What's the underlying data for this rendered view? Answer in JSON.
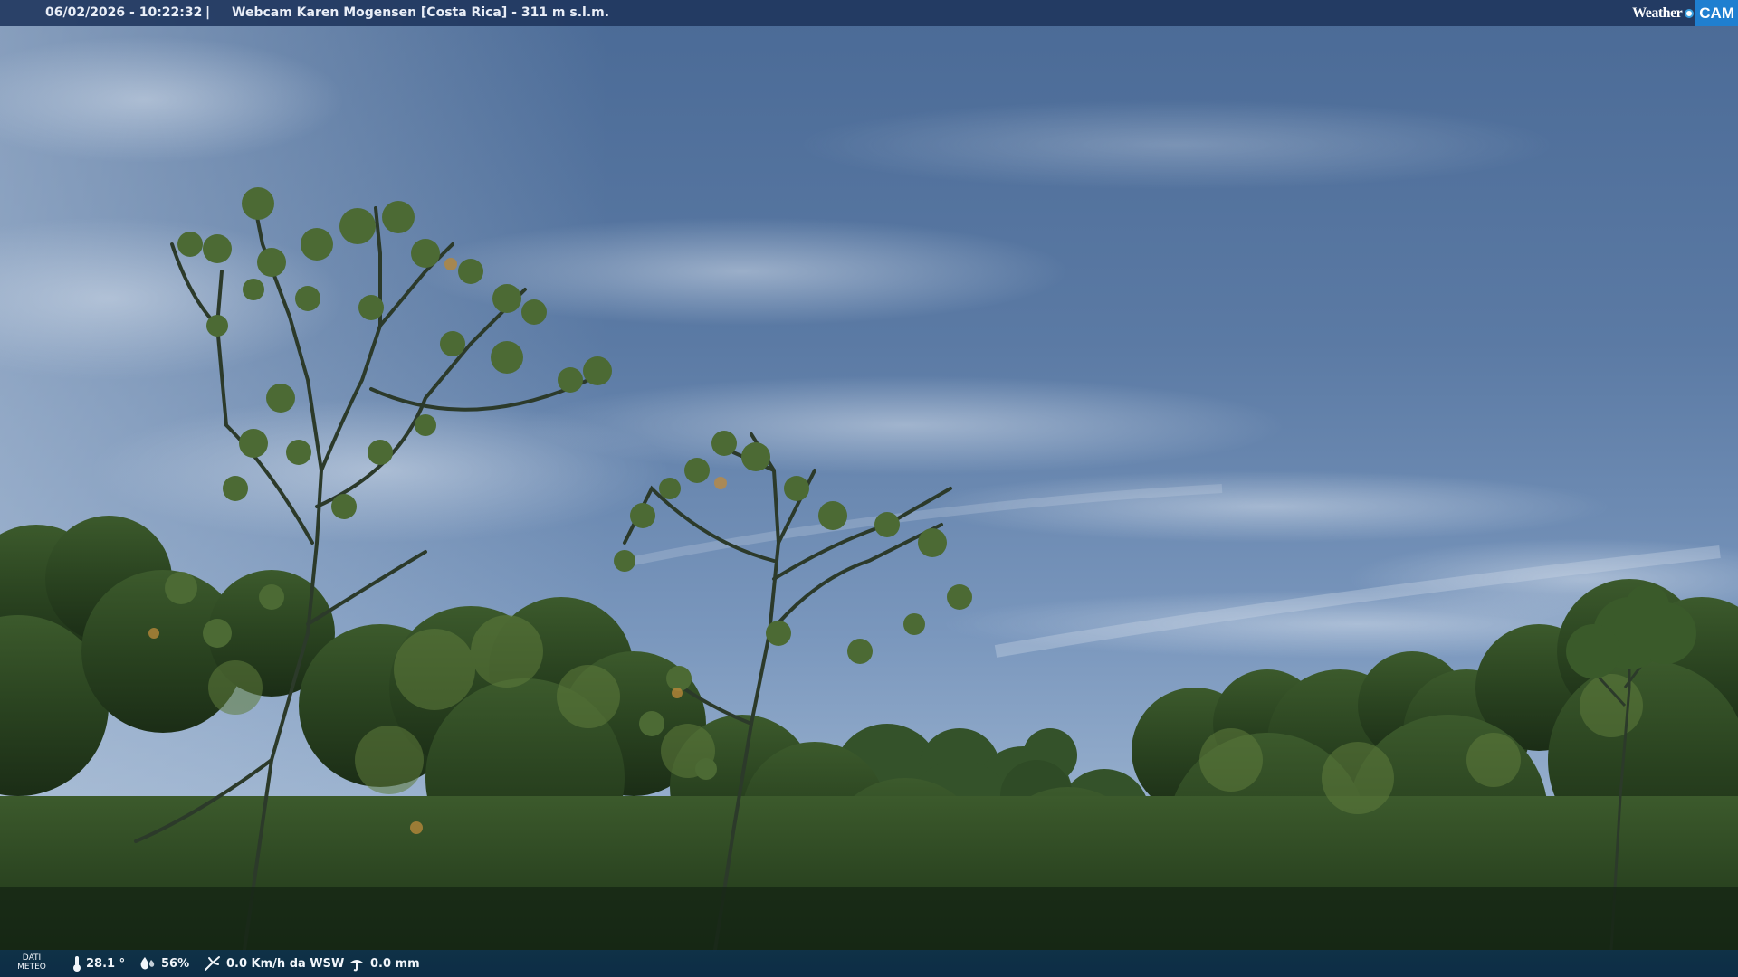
{
  "header": {
    "datetime": "06/02/2026 - 10:22:32",
    "separator": "|",
    "caption": "Webcam Karen Mogensen [Costa Rica]  - 311 m s.l.m."
  },
  "logo": {
    "weather_text": "Weather",
    "cam_text": "CAM",
    "icon": "globe-dot-icon"
  },
  "weather": {
    "label_line1": "DATI",
    "label_line2": "METEO",
    "temperature": "28.1 °",
    "humidity": "56%",
    "wind": "0.0 Km/h da WSW",
    "rain": "0.0 mm",
    "icons": {
      "temperature": "thermometer-icon",
      "humidity": "humidity-icon",
      "wind": "wind-icon",
      "rain": "rain-gauge-icon"
    }
  },
  "colors": {
    "top_bar": "#1e345c",
    "bottom_bar": "#0e3452",
    "logo_accent": "#1f7fd0",
    "sky_top": "#4d6d98",
    "sky_horizon": "#9cb3cf",
    "foliage": "#1f3a1c"
  }
}
